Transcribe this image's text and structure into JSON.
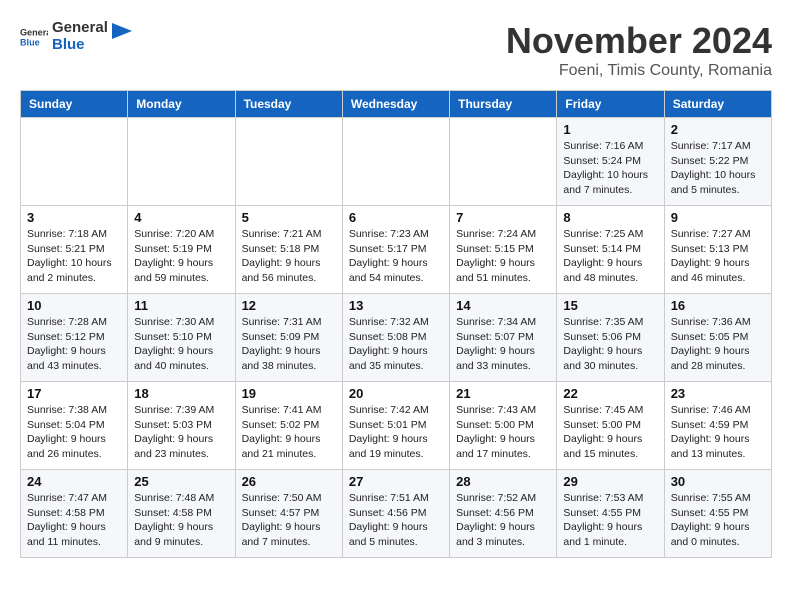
{
  "header": {
    "logo_general": "General",
    "logo_blue": "Blue",
    "month": "November 2024",
    "location": "Foeni, Timis County, Romania"
  },
  "weekdays": [
    "Sunday",
    "Monday",
    "Tuesday",
    "Wednesday",
    "Thursday",
    "Friday",
    "Saturday"
  ],
  "weeks": [
    [
      {
        "day": "",
        "info": ""
      },
      {
        "day": "",
        "info": ""
      },
      {
        "day": "",
        "info": ""
      },
      {
        "day": "",
        "info": ""
      },
      {
        "day": "",
        "info": ""
      },
      {
        "day": "1",
        "info": "Sunrise: 7:16 AM\nSunset: 5:24 PM\nDaylight: 10 hours and 7 minutes."
      },
      {
        "day": "2",
        "info": "Sunrise: 7:17 AM\nSunset: 5:22 PM\nDaylight: 10 hours and 5 minutes."
      }
    ],
    [
      {
        "day": "3",
        "info": "Sunrise: 7:18 AM\nSunset: 5:21 PM\nDaylight: 10 hours and 2 minutes."
      },
      {
        "day": "4",
        "info": "Sunrise: 7:20 AM\nSunset: 5:19 PM\nDaylight: 9 hours and 59 minutes."
      },
      {
        "day": "5",
        "info": "Sunrise: 7:21 AM\nSunset: 5:18 PM\nDaylight: 9 hours and 56 minutes."
      },
      {
        "day": "6",
        "info": "Sunrise: 7:23 AM\nSunset: 5:17 PM\nDaylight: 9 hours and 54 minutes."
      },
      {
        "day": "7",
        "info": "Sunrise: 7:24 AM\nSunset: 5:15 PM\nDaylight: 9 hours and 51 minutes."
      },
      {
        "day": "8",
        "info": "Sunrise: 7:25 AM\nSunset: 5:14 PM\nDaylight: 9 hours and 48 minutes."
      },
      {
        "day": "9",
        "info": "Sunrise: 7:27 AM\nSunset: 5:13 PM\nDaylight: 9 hours and 46 minutes."
      }
    ],
    [
      {
        "day": "10",
        "info": "Sunrise: 7:28 AM\nSunset: 5:12 PM\nDaylight: 9 hours and 43 minutes."
      },
      {
        "day": "11",
        "info": "Sunrise: 7:30 AM\nSunset: 5:10 PM\nDaylight: 9 hours and 40 minutes."
      },
      {
        "day": "12",
        "info": "Sunrise: 7:31 AM\nSunset: 5:09 PM\nDaylight: 9 hours and 38 minutes."
      },
      {
        "day": "13",
        "info": "Sunrise: 7:32 AM\nSunset: 5:08 PM\nDaylight: 9 hours and 35 minutes."
      },
      {
        "day": "14",
        "info": "Sunrise: 7:34 AM\nSunset: 5:07 PM\nDaylight: 9 hours and 33 minutes."
      },
      {
        "day": "15",
        "info": "Sunrise: 7:35 AM\nSunset: 5:06 PM\nDaylight: 9 hours and 30 minutes."
      },
      {
        "day": "16",
        "info": "Sunrise: 7:36 AM\nSunset: 5:05 PM\nDaylight: 9 hours and 28 minutes."
      }
    ],
    [
      {
        "day": "17",
        "info": "Sunrise: 7:38 AM\nSunset: 5:04 PM\nDaylight: 9 hours and 26 minutes."
      },
      {
        "day": "18",
        "info": "Sunrise: 7:39 AM\nSunset: 5:03 PM\nDaylight: 9 hours and 23 minutes."
      },
      {
        "day": "19",
        "info": "Sunrise: 7:41 AM\nSunset: 5:02 PM\nDaylight: 9 hours and 21 minutes."
      },
      {
        "day": "20",
        "info": "Sunrise: 7:42 AM\nSunset: 5:01 PM\nDaylight: 9 hours and 19 minutes."
      },
      {
        "day": "21",
        "info": "Sunrise: 7:43 AM\nSunset: 5:00 PM\nDaylight: 9 hours and 17 minutes."
      },
      {
        "day": "22",
        "info": "Sunrise: 7:45 AM\nSunset: 5:00 PM\nDaylight: 9 hours and 15 minutes."
      },
      {
        "day": "23",
        "info": "Sunrise: 7:46 AM\nSunset: 4:59 PM\nDaylight: 9 hours and 13 minutes."
      }
    ],
    [
      {
        "day": "24",
        "info": "Sunrise: 7:47 AM\nSunset: 4:58 PM\nDaylight: 9 hours and 11 minutes."
      },
      {
        "day": "25",
        "info": "Sunrise: 7:48 AM\nSunset: 4:58 PM\nDaylight: 9 hours and 9 minutes."
      },
      {
        "day": "26",
        "info": "Sunrise: 7:50 AM\nSunset: 4:57 PM\nDaylight: 9 hours and 7 minutes."
      },
      {
        "day": "27",
        "info": "Sunrise: 7:51 AM\nSunset: 4:56 PM\nDaylight: 9 hours and 5 minutes."
      },
      {
        "day": "28",
        "info": "Sunrise: 7:52 AM\nSunset: 4:56 PM\nDaylight: 9 hours and 3 minutes."
      },
      {
        "day": "29",
        "info": "Sunrise: 7:53 AM\nSunset: 4:55 PM\nDaylight: 9 hours and 1 minute."
      },
      {
        "day": "30",
        "info": "Sunrise: 7:55 AM\nSunset: 4:55 PM\nDaylight: 9 hours and 0 minutes."
      }
    ]
  ]
}
